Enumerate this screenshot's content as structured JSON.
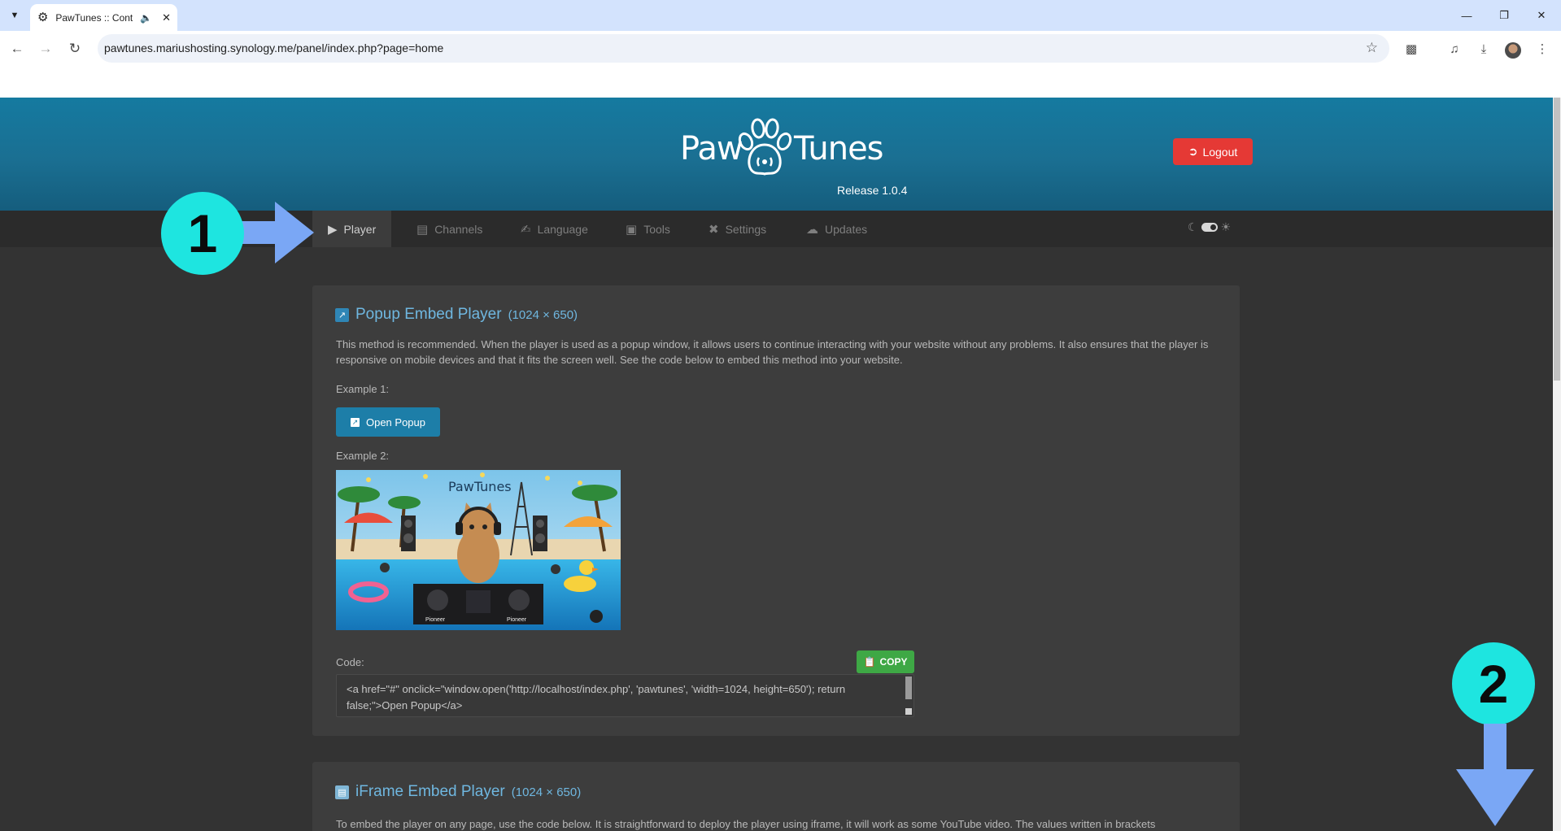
{
  "browser": {
    "tab_title": "PawTunes :: Control Panel",
    "url": "pawtunes.mariushosting.synology.me/panel/index.php?page=home"
  },
  "app": {
    "logo_left": "Paw",
    "logo_right": "Tunes",
    "release": "Release 1.0.4",
    "logout_label": "Logout"
  },
  "nav": {
    "items": [
      {
        "label": "Player",
        "icon": "play-circle-icon"
      },
      {
        "label": "Channels",
        "icon": "radio-icon"
      },
      {
        "label": "Language",
        "icon": "language-icon"
      },
      {
        "label": "Tools",
        "icon": "toolbox-icon"
      },
      {
        "label": "Settings",
        "icon": "tools-icon"
      },
      {
        "label": "Updates",
        "icon": "cloud-download-icon"
      }
    ]
  },
  "popup_section": {
    "title": "Popup Embed Player",
    "size": "(1024 × 650)",
    "description": "This method is recommended. When the player is used as a popup window, it allows users to continue interacting with your website without any problems. It also ensures that the player is responsive on mobile devices and that it fits the screen well. See the code below to embed this method into your website.",
    "example1_label": "Example 1:",
    "open_popup_label": "Open Popup",
    "example2_label": "Example 2:",
    "banner_logo": "PawTunes",
    "code_label": "Code:",
    "copy_label": "COPY",
    "code": "<a href=\"#\" onclick=\"window.open('http://localhost/index.php', 'pawtunes', 'width=1024, height=650'); return false;\">Open Popup</a>"
  },
  "iframe_section": {
    "title": "iFrame Embed Player",
    "size": "(1024 × 650)",
    "description": "To embed the player on any page, use the code below. It is straightforward to deploy the player using iframe, it will work as some YouTube video. The values written in brackets"
  },
  "annotations": {
    "step1": "1",
    "step2": "2"
  },
  "colors": {
    "header_blue": "#1a6f92",
    "logout_red": "#e53935",
    "copy_green": "#3ea845",
    "badge_cyan": "#1ee5e0",
    "arrow_blue": "#7aa7f5",
    "title_blue": "#6fb7e0"
  }
}
